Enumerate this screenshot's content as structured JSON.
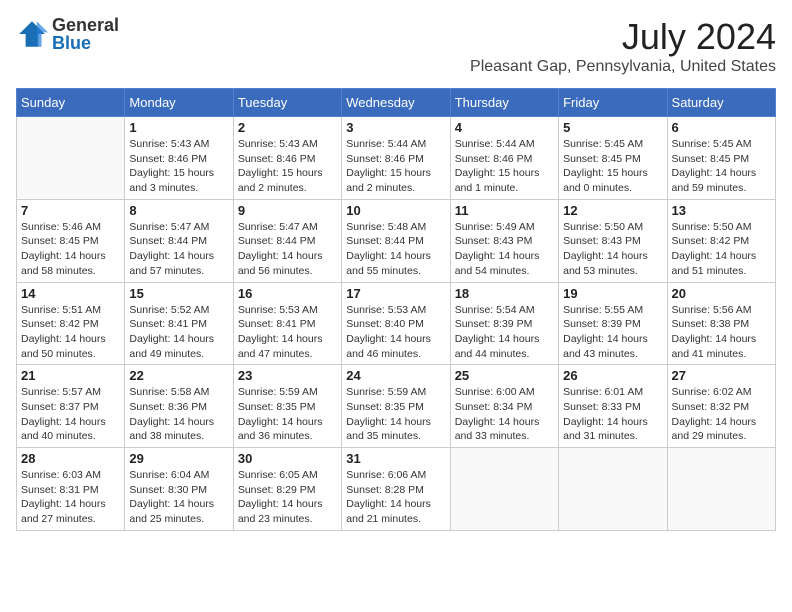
{
  "logo": {
    "general": "General",
    "blue": "Blue"
  },
  "title": "July 2024",
  "location": "Pleasant Gap, Pennsylvania, United States",
  "weekdays": [
    "Sunday",
    "Monday",
    "Tuesday",
    "Wednesday",
    "Thursday",
    "Friday",
    "Saturday"
  ],
  "weeks": [
    [
      {
        "day": "",
        "info": ""
      },
      {
        "day": "1",
        "info": "Sunrise: 5:43 AM\nSunset: 8:46 PM\nDaylight: 15 hours\nand 3 minutes."
      },
      {
        "day": "2",
        "info": "Sunrise: 5:43 AM\nSunset: 8:46 PM\nDaylight: 15 hours\nand 2 minutes."
      },
      {
        "day": "3",
        "info": "Sunrise: 5:44 AM\nSunset: 8:46 PM\nDaylight: 15 hours\nand 2 minutes."
      },
      {
        "day": "4",
        "info": "Sunrise: 5:44 AM\nSunset: 8:46 PM\nDaylight: 15 hours\nand 1 minute."
      },
      {
        "day": "5",
        "info": "Sunrise: 5:45 AM\nSunset: 8:45 PM\nDaylight: 15 hours\nand 0 minutes."
      },
      {
        "day": "6",
        "info": "Sunrise: 5:45 AM\nSunset: 8:45 PM\nDaylight: 14 hours\nand 59 minutes."
      }
    ],
    [
      {
        "day": "7",
        "info": "Sunrise: 5:46 AM\nSunset: 8:45 PM\nDaylight: 14 hours\nand 58 minutes."
      },
      {
        "day": "8",
        "info": "Sunrise: 5:47 AM\nSunset: 8:44 PM\nDaylight: 14 hours\nand 57 minutes."
      },
      {
        "day": "9",
        "info": "Sunrise: 5:47 AM\nSunset: 8:44 PM\nDaylight: 14 hours\nand 56 minutes."
      },
      {
        "day": "10",
        "info": "Sunrise: 5:48 AM\nSunset: 8:44 PM\nDaylight: 14 hours\nand 55 minutes."
      },
      {
        "day": "11",
        "info": "Sunrise: 5:49 AM\nSunset: 8:43 PM\nDaylight: 14 hours\nand 54 minutes."
      },
      {
        "day": "12",
        "info": "Sunrise: 5:50 AM\nSunset: 8:43 PM\nDaylight: 14 hours\nand 53 minutes."
      },
      {
        "day": "13",
        "info": "Sunrise: 5:50 AM\nSunset: 8:42 PM\nDaylight: 14 hours\nand 51 minutes."
      }
    ],
    [
      {
        "day": "14",
        "info": "Sunrise: 5:51 AM\nSunset: 8:42 PM\nDaylight: 14 hours\nand 50 minutes."
      },
      {
        "day": "15",
        "info": "Sunrise: 5:52 AM\nSunset: 8:41 PM\nDaylight: 14 hours\nand 49 minutes."
      },
      {
        "day": "16",
        "info": "Sunrise: 5:53 AM\nSunset: 8:41 PM\nDaylight: 14 hours\nand 47 minutes."
      },
      {
        "day": "17",
        "info": "Sunrise: 5:53 AM\nSunset: 8:40 PM\nDaylight: 14 hours\nand 46 minutes."
      },
      {
        "day": "18",
        "info": "Sunrise: 5:54 AM\nSunset: 8:39 PM\nDaylight: 14 hours\nand 44 minutes."
      },
      {
        "day": "19",
        "info": "Sunrise: 5:55 AM\nSunset: 8:39 PM\nDaylight: 14 hours\nand 43 minutes."
      },
      {
        "day": "20",
        "info": "Sunrise: 5:56 AM\nSunset: 8:38 PM\nDaylight: 14 hours\nand 41 minutes."
      }
    ],
    [
      {
        "day": "21",
        "info": "Sunrise: 5:57 AM\nSunset: 8:37 PM\nDaylight: 14 hours\nand 40 minutes."
      },
      {
        "day": "22",
        "info": "Sunrise: 5:58 AM\nSunset: 8:36 PM\nDaylight: 14 hours\nand 38 minutes."
      },
      {
        "day": "23",
        "info": "Sunrise: 5:59 AM\nSunset: 8:35 PM\nDaylight: 14 hours\nand 36 minutes."
      },
      {
        "day": "24",
        "info": "Sunrise: 5:59 AM\nSunset: 8:35 PM\nDaylight: 14 hours\nand 35 minutes."
      },
      {
        "day": "25",
        "info": "Sunrise: 6:00 AM\nSunset: 8:34 PM\nDaylight: 14 hours\nand 33 minutes."
      },
      {
        "day": "26",
        "info": "Sunrise: 6:01 AM\nSunset: 8:33 PM\nDaylight: 14 hours\nand 31 minutes."
      },
      {
        "day": "27",
        "info": "Sunrise: 6:02 AM\nSunset: 8:32 PM\nDaylight: 14 hours\nand 29 minutes."
      }
    ],
    [
      {
        "day": "28",
        "info": "Sunrise: 6:03 AM\nSunset: 8:31 PM\nDaylight: 14 hours\nand 27 minutes."
      },
      {
        "day": "29",
        "info": "Sunrise: 6:04 AM\nSunset: 8:30 PM\nDaylight: 14 hours\nand 25 minutes."
      },
      {
        "day": "30",
        "info": "Sunrise: 6:05 AM\nSunset: 8:29 PM\nDaylight: 14 hours\nand 23 minutes."
      },
      {
        "day": "31",
        "info": "Sunrise: 6:06 AM\nSunset: 8:28 PM\nDaylight: 14 hours\nand 21 minutes."
      },
      {
        "day": "",
        "info": ""
      },
      {
        "day": "",
        "info": ""
      },
      {
        "day": "",
        "info": ""
      }
    ]
  ]
}
